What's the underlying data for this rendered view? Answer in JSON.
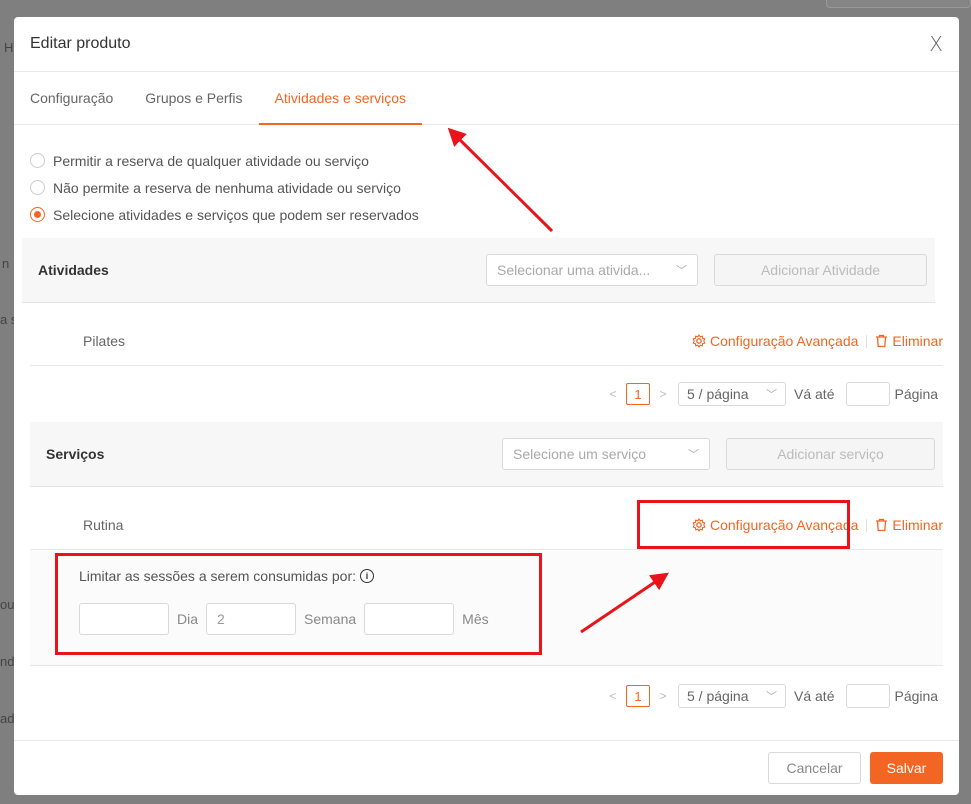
{
  "background": {
    "fragments": [
      "H",
      "n",
      "a s",
      "ou",
      "nd",
      "ada"
    ]
  },
  "modal": {
    "title": "Editar produto",
    "close_label": "X"
  },
  "tabs": [
    {
      "label": "Configuração",
      "active": false
    },
    {
      "label": "Grupos e Perfis",
      "active": false
    },
    {
      "label": "Atividades e serviços",
      "active": true
    }
  ],
  "reservation_options": [
    {
      "label": "Permitir a reserva de qualquer atividade ou serviço",
      "checked": false
    },
    {
      "label": "Não permite a reserva de nenhuma atividade ou serviço",
      "checked": false
    },
    {
      "label": "Selecione atividades e serviços que podem ser reservados",
      "checked": true
    }
  ],
  "activities": {
    "title": "Atividades",
    "select_placeholder": "Selecionar uma ativida...",
    "add_label": "Adicionar Atividade",
    "items": [
      {
        "name": "Pilates"
      }
    ],
    "advanced_label": "Configuração Avançada",
    "delete_label": "Eliminar",
    "pager": {
      "page": "1",
      "page_size": "5 / página",
      "goto_label": "Vá até",
      "page_label": "Página"
    }
  },
  "services": {
    "title": "Serviços",
    "select_placeholder": "Selecione um serviço",
    "add_label": "Adicionar serviço",
    "items": [
      {
        "name": "Rutina"
      }
    ],
    "advanced_label": "Configuração Avançada",
    "delete_label": "Eliminar",
    "limit": {
      "label": "Limitar as sessões a serem consumidas por:",
      "info_icon": "i",
      "day_value": "",
      "day_unit": "Dia",
      "week_value": "2",
      "week_unit": "Semana",
      "month_value": "",
      "month_unit": "Mês"
    },
    "pager": {
      "page": "1",
      "page_size": "5 / página",
      "goto_label": "Vá até",
      "page_label": "Página"
    }
  },
  "footer": {
    "cancel_label": "Cancelar",
    "save_label": "Salvar"
  },
  "colors": {
    "accent": "#f26522",
    "annotation_red": "#e8141a"
  }
}
